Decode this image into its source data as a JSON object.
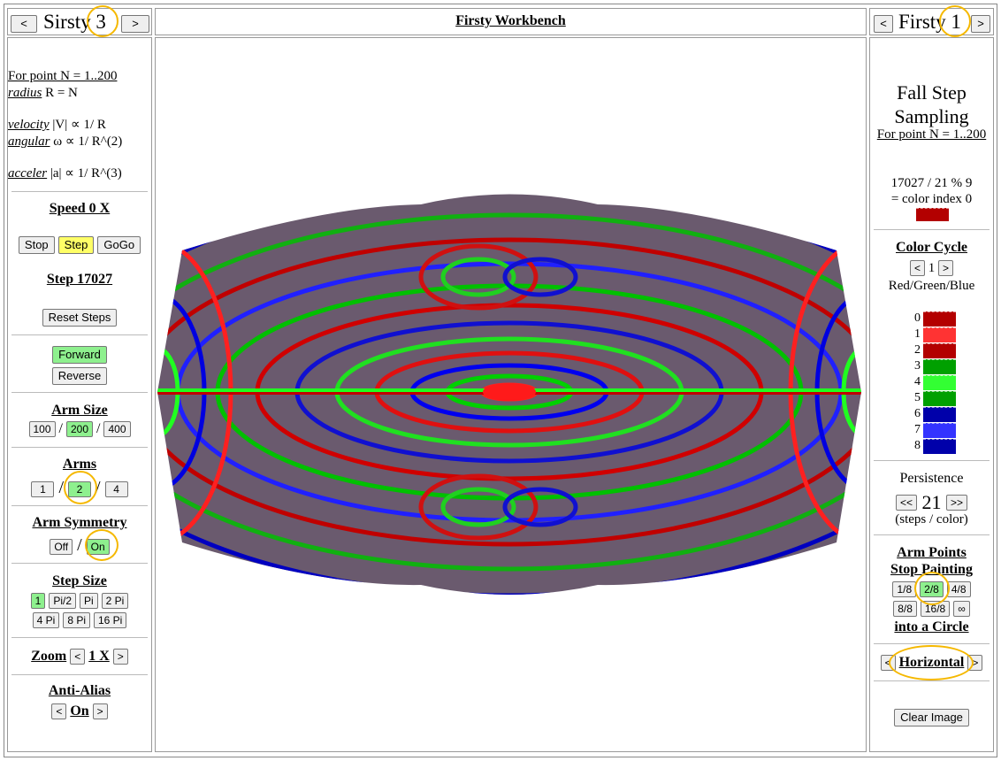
{
  "left_header": {
    "prev": "<",
    "title": "Sirsty 3",
    "next": ">"
  },
  "center_header": {
    "title": "Firsty Workbench"
  },
  "right_header": {
    "prev": "<",
    "title": "Firsty 1",
    "next": ">"
  },
  "left": {
    "formula": {
      "l1": "For point N = 1..200",
      "l2a": "radius",
      "l2b": " R = N",
      "l3a": "velocity",
      "l3b": " |V| ∝ 1/ R",
      "l4a": "angular",
      "l4b": " ω ∝ 1/ R^(2)",
      "l5a": "acceler",
      "l5b": " |a| ∝ 1/ R^(3)"
    },
    "speed": {
      "label": "Speed 0 X",
      "stop": "Stop",
      "step": "Step",
      "gogo": "GoGo"
    },
    "step_count": "Step 17027",
    "reset": "Reset Steps",
    "forward": "Forward",
    "reverse": "Reverse",
    "arm_size": {
      "label": "Arm Size",
      "o1": "100",
      "o2": "200",
      "o3": "400",
      "sep": "/"
    },
    "arms": {
      "label": "Arms",
      "o1": "1",
      "o2": "2",
      "o3": "4",
      "sep": "/"
    },
    "arm_symmetry": {
      "label": "Arm Symmetry",
      "off": "Off",
      "on": "On",
      "sep": "/"
    },
    "step_size": {
      "label": "Step Size",
      "o1": "1",
      "o2": "Pi/2",
      "o3": "Pi",
      "o4": "2 Pi",
      "o5": "4 Pi",
      "o6": "8 Pi",
      "o7": "16 Pi"
    },
    "zoom": {
      "label": "Zoom",
      "prev": "<",
      "value": "1 X",
      "next": ">"
    },
    "anti_alias": {
      "label": "Anti-Alias",
      "prev": "<",
      "value": "On",
      "next": ">"
    }
  },
  "right": {
    "title1": "Fall Step",
    "title2": "Sampling",
    "sub": "For point N = 1..200",
    "calc1": "17027 / 21 % 9",
    "calc2": "= color index 0",
    "color_cycle": {
      "label": "Color Cycle",
      "prev": "<",
      "value": "1",
      "next": ">",
      "name": "Red/Green/Blue"
    },
    "palette": [
      {
        "idx": "0",
        "color": "#b30000"
      },
      {
        "idx": "1",
        "color": "#ff3333"
      },
      {
        "idx": "2",
        "color": "#b30000"
      },
      {
        "idx": "3",
        "color": "#00a000"
      },
      {
        "idx": "4",
        "color": "#33ff33"
      },
      {
        "idx": "5",
        "color": "#00a000"
      },
      {
        "idx": "6",
        "color": "#0000aa"
      },
      {
        "idx": "7",
        "color": "#3333ff"
      },
      {
        "idx": "8",
        "color": "#0000aa"
      }
    ],
    "persistence": {
      "label": "Persistence",
      "prev": "<<",
      "value": "21",
      "next": ">>",
      "unit": "(steps / color)"
    },
    "arm_points": {
      "label1": "Arm Points",
      "label2": "Stop Painting",
      "o1": "1/8",
      "o2": "2/8",
      "o3": "4/8",
      "o4": "8/8",
      "o5": "16/8",
      "o6": "∞",
      "label3": "into a Circle"
    },
    "orientation": {
      "prev": "<",
      "value": "Horizontal",
      "next": ">"
    },
    "clear": "Clear Image"
  },
  "colors": {
    "selected_green": "#8ef08e",
    "selected_yellow": "#ffff66",
    "highlight_circle": "#f5b800"
  }
}
